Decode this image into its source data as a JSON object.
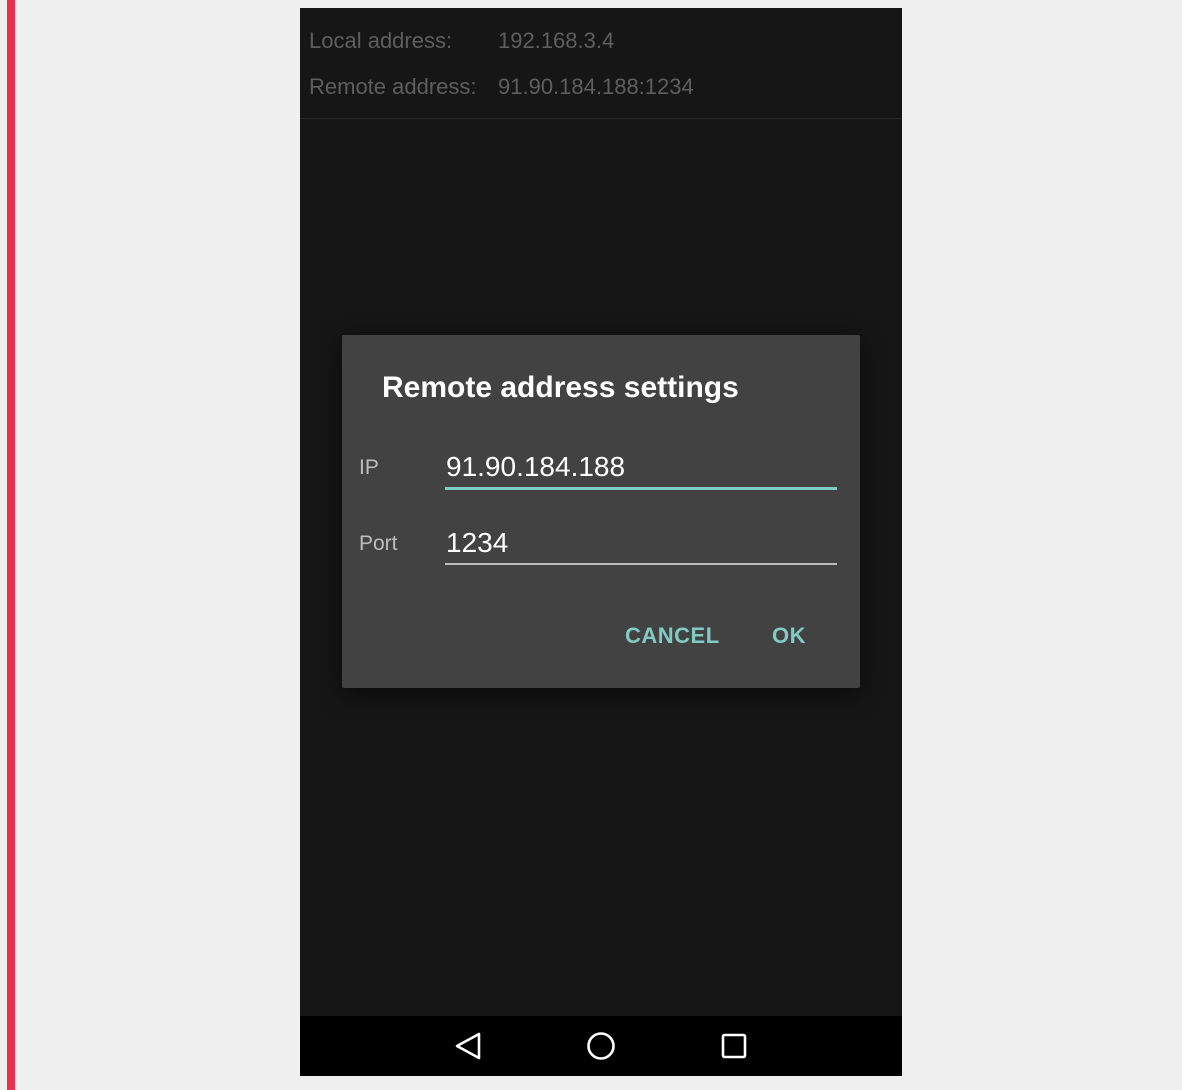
{
  "status_info": {
    "local_label": "Local address:",
    "local_value": "192.168.3.4",
    "remote_label": "Remote address:",
    "remote_value": "91.90.184.188:1234"
  },
  "dialog": {
    "title": "Remote address settings",
    "ip_label": "IP",
    "ip_value": "91.90.184.188",
    "port_label": "Port",
    "port_value": "1234",
    "cancel_label": "CANCEL",
    "ok_label": "OK"
  },
  "navbar": {
    "icons": [
      "back-icon",
      "home-icon",
      "recents-icon"
    ]
  },
  "colors": {
    "accent": "#80cbc4",
    "dialog_bg": "#424242",
    "screen_bg": "#161616",
    "side_bar": "#e8334f"
  }
}
